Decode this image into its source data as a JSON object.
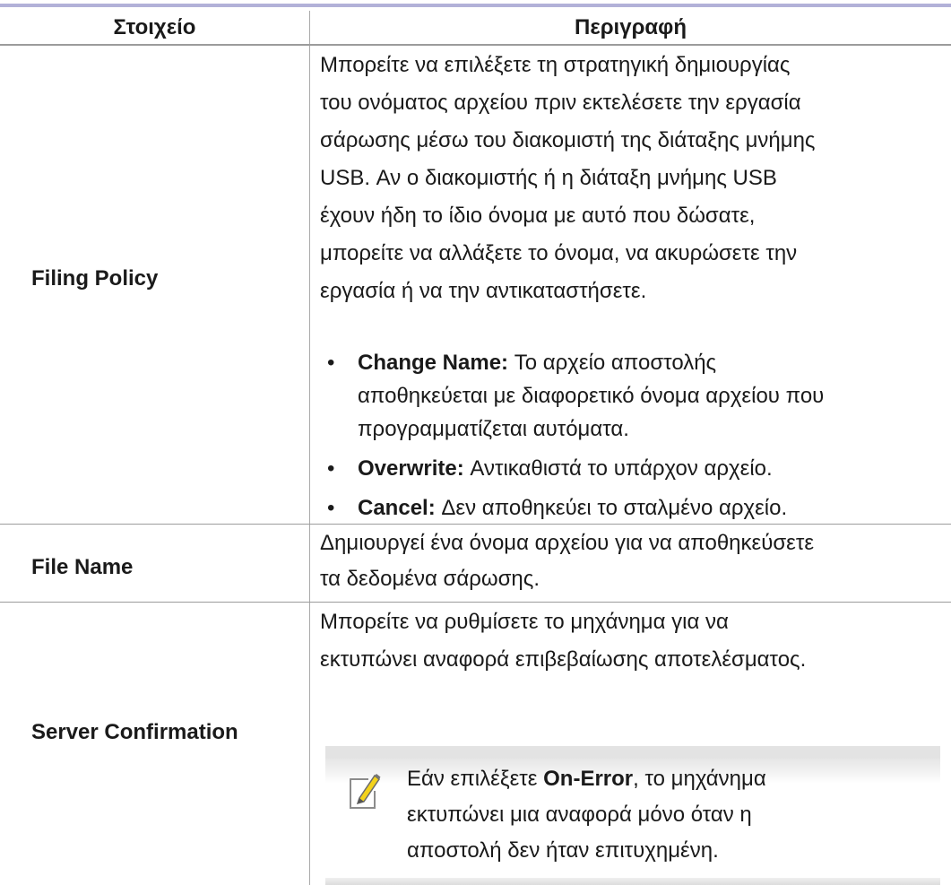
{
  "table": {
    "header": {
      "col_item": "Στοιχείο",
      "col_desc": "Περιγραφή"
    },
    "rows": [
      {
        "item": "Filing Policy",
        "description": [
          "Μπορείτε να επιλέξετε τη στρατηγική δημιουργίας",
          "του ονόματος αρχείου πριν εκτελέσετε την εργασία",
          "σάρωσης μέσω του διακομιστή της διάταξης μνήμης",
          "USB. Αν ο διακομιστής ή η διάταξη μνήμης USB",
          "έχουν ήδη το ίδιο όνομα με αυτό που δώσατε,",
          "μπορείτε να αλλάξετε το όνομα, να ακυρώσετε την",
          "εργασία ή να την αντικαταστήσετε."
        ],
        "bullets": [
          {
            "bullet": "•",
            "term": "Change Name:",
            "lines": [
              " Το αρχείο αποστολής",
              "αποθηκεύεται με διαφορετικό όνομα αρχείου που",
              "προγραμματίζεται αυτόματα."
            ]
          },
          {
            "bullet": "•",
            "term": "Overwrite:",
            "lines": [
              " Αντικαθιστά το υπάρχον αρχείο."
            ]
          },
          {
            "bullet": "•",
            "term": "Cancel:",
            "lines": [
              " Δεν αποθηκεύει το σταλμένο αρχείο."
            ]
          }
        ]
      },
      {
        "item": "File Name",
        "description": [
          "Δημιουργεί ένα όνομα αρχείου για να αποθηκεύσετε",
          "τα δεδομένα σάρωσης."
        ]
      },
      {
        "item": "Server Confirmation",
        "description": [
          "Μπορείτε να ρυθμίσετε το μηχάνημα για να",
          "εκτυπώνει αναφορά επιβεβαίωσης αποτελέσματος."
        ],
        "note": {
          "icon": "note-pencil-icon",
          "pre": "Εάν επιλέξετε ",
          "bold": "On-Error",
          "post_first": ", το μηχάνημα",
          "lines": [
            "εκτυπώνει μια αναφορά μόνο όταν η",
            "αποστολή δεν ήταν επιτυχημένη."
          ]
        }
      }
    ]
  }
}
